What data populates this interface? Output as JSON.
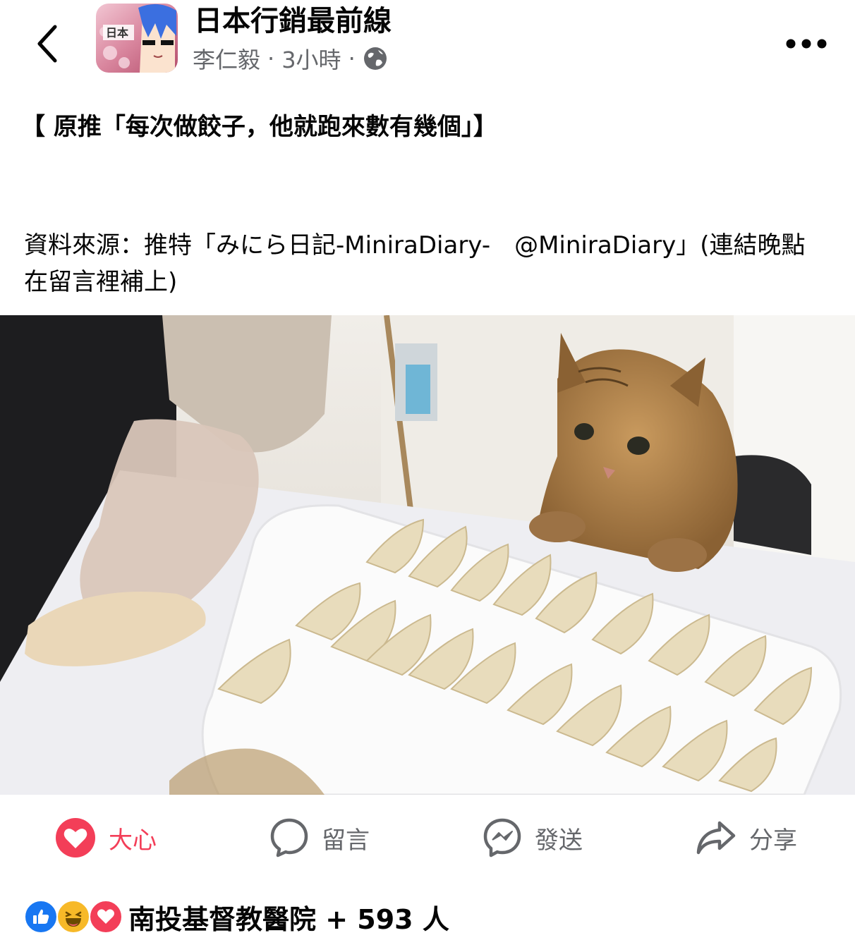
{
  "header": {
    "page_name": "日本行銷最前線",
    "author": "李仁毅",
    "separator": "·",
    "time": "3小時",
    "avatar_text": "日本",
    "back_icon": "chevron-left-icon",
    "more_icon": "more-horizontal-icon",
    "privacy_icon": "globe-icon"
  },
  "post": {
    "title": "【 原推「每次做餃子，他就跑來數有幾個」】",
    "source": "資料來源：推特「みにら日記-MiniraDiary-　@MiniraDiary」(連結晚點在留言裡補上)"
  },
  "actions": {
    "love": {
      "label": "大心",
      "icon": "heart-reaction-icon"
    },
    "comment": {
      "label": "留言",
      "icon": "comment-bubble-icon"
    },
    "send": {
      "label": "發送",
      "icon": "messenger-icon"
    },
    "share": {
      "label": "分享",
      "icon": "share-arrow-icon"
    }
  },
  "reactions": {
    "summary": "南投基督教醫院 + 593 人",
    "icons": [
      "like-reaction-icon",
      "haha-reaction-icon",
      "love-reaction-icon"
    ]
  },
  "colors": {
    "love_red": "#f33e58",
    "like_blue": "#1877f2",
    "haha_yellow": "#f7b928",
    "secondary_text": "#65676b"
  }
}
